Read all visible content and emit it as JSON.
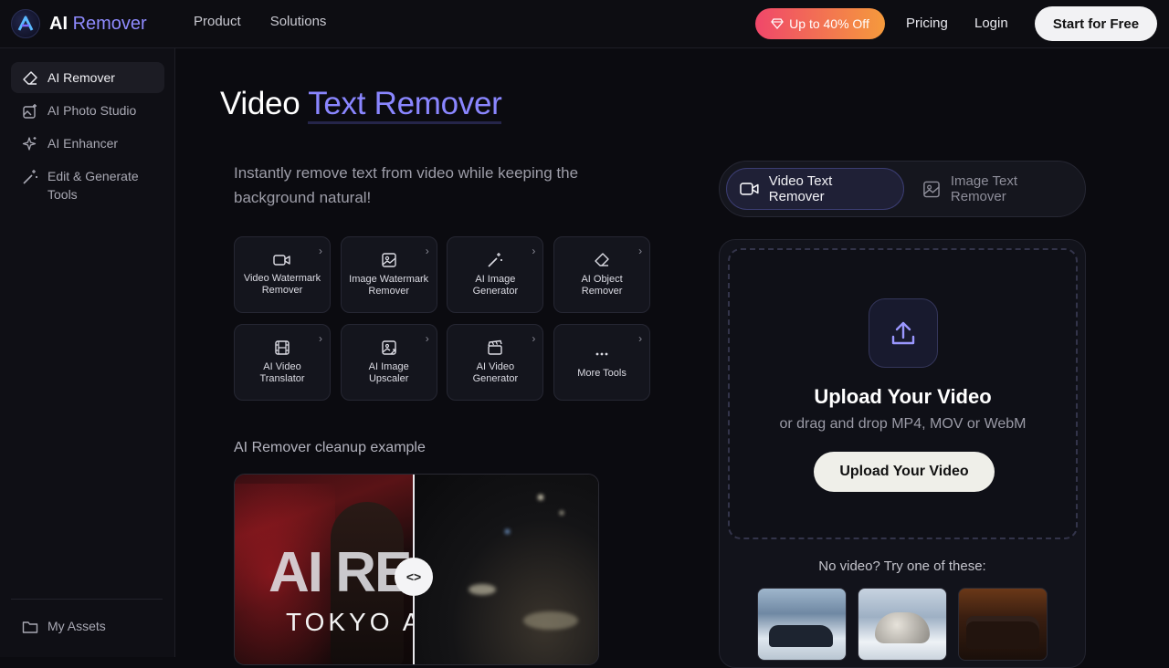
{
  "header": {
    "brand_ai": "AI",
    "brand_name": "Remover",
    "nav": [
      "Product",
      "Solutions"
    ],
    "promo": "Up to 40% Off",
    "pricing": "Pricing",
    "login": "Login",
    "cta": "Start for Free"
  },
  "sidebar": {
    "items": [
      {
        "label": "AI Remover",
        "icon": "eraser-icon",
        "active": true
      },
      {
        "label": "AI Photo Studio",
        "icon": "image-sparkle-icon"
      },
      {
        "label": "AI Enhancer",
        "icon": "sparkle-icon"
      },
      {
        "label": "Edit & Generate Tools",
        "icon": "magic-wand-icon"
      }
    ],
    "bottom": {
      "label": "My Assets",
      "icon": "folder-icon"
    }
  },
  "main": {
    "title_plain": "Video ",
    "title_highlight": "Text Remover",
    "subtitle": "Instantly remove text from video while keeping the background natural!",
    "tools": [
      {
        "label": "Video Watermark Remover",
        "icon": "video-icon"
      },
      {
        "label": "Image Watermark Remover",
        "icon": "image-icon"
      },
      {
        "label": "AI Image Generator",
        "icon": "magic-wand-icon"
      },
      {
        "label": "AI Object Remover",
        "icon": "eraser-icon"
      },
      {
        "label": "AI Video Translator",
        "icon": "film-icon"
      },
      {
        "label": "AI Image Upscaler",
        "icon": "image-upscale-icon"
      },
      {
        "label": "AI Video Generator",
        "icon": "clapperboard-icon"
      },
      {
        "label": "More Tools",
        "icon": "more-icon"
      }
    ],
    "example_label": "AI Remover cleanup example",
    "example_overlay_big": "AI RE",
    "example_overlay_small": "TOKYO AF",
    "example_handle": "<>"
  },
  "panel": {
    "tabs": [
      {
        "label": "Video Text Remover",
        "icon": "video-icon",
        "active": true
      },
      {
        "label": "Image Text Remover",
        "icon": "image-icon",
        "active": false
      }
    ],
    "upload_title": "Upload Your Video",
    "upload_sub": "or drag and drop MP4, MOV or WebM",
    "upload_button": "Upload Your Video",
    "try_label": "No video? Try one of these:"
  },
  "colors": {
    "accent": "#8a86ff",
    "background": "#0b0b10",
    "promo_start": "#f0476a",
    "promo_end": "#f59a3c"
  }
}
